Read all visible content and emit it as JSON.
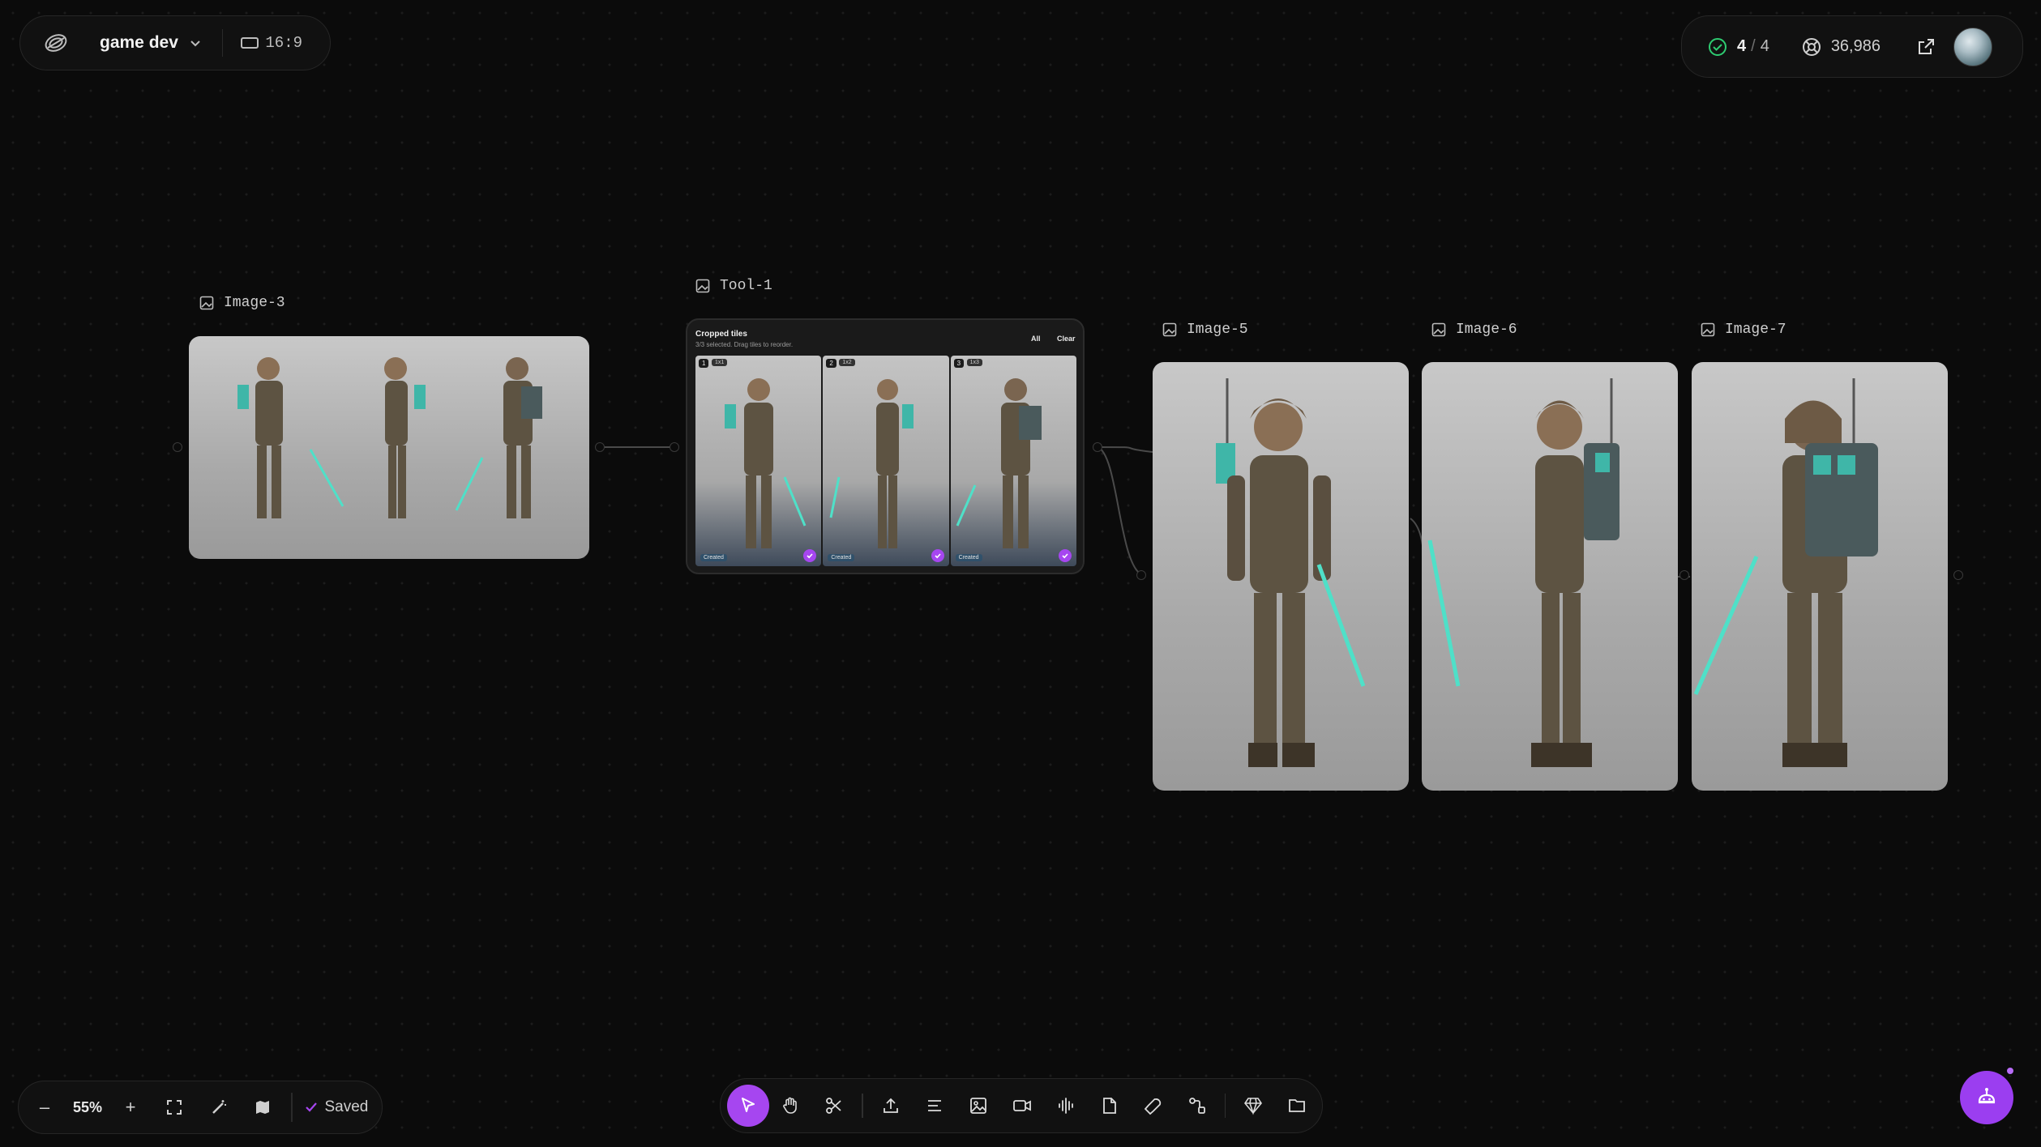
{
  "header": {
    "project_name": "game dev",
    "aspect_ratio": "16:9"
  },
  "status": {
    "done": "4",
    "separator": "/",
    "total": "4",
    "credits": "36,986"
  },
  "nodes": {
    "image3": {
      "label": "Image-3"
    },
    "tool1": {
      "label": "Tool-1",
      "title": "Cropped tiles",
      "subtitle": "3/3 selected. Drag tiles to reorder.",
      "all_label": "All",
      "clear_label": "Clear",
      "tiles": [
        {
          "num": "1",
          "ratio": "1x1",
          "caption": "Created",
          "selected": true
        },
        {
          "num": "2",
          "ratio": "1x2",
          "caption": "Created",
          "selected": true
        },
        {
          "num": "3",
          "ratio": "1x3",
          "caption": "Created",
          "selected": true
        }
      ]
    },
    "image5": {
      "label": "Image-5"
    },
    "image6": {
      "label": "Image-6"
    },
    "image7": {
      "label": "Image-7"
    }
  },
  "bottom_bar": {
    "zoom_out": "–",
    "zoom_level": "55%",
    "zoom_in": "+",
    "saved_label": "Saved"
  },
  "toolbar": {
    "tools": [
      "select",
      "hand",
      "cut",
      "upload",
      "text",
      "image",
      "video",
      "audio",
      "document",
      "tools",
      "connect",
      "gem",
      "folder"
    ],
    "active": "select"
  },
  "colors": {
    "accent": "#a646f0",
    "success": "#2ecc71",
    "background": "#0b0b0b"
  }
}
